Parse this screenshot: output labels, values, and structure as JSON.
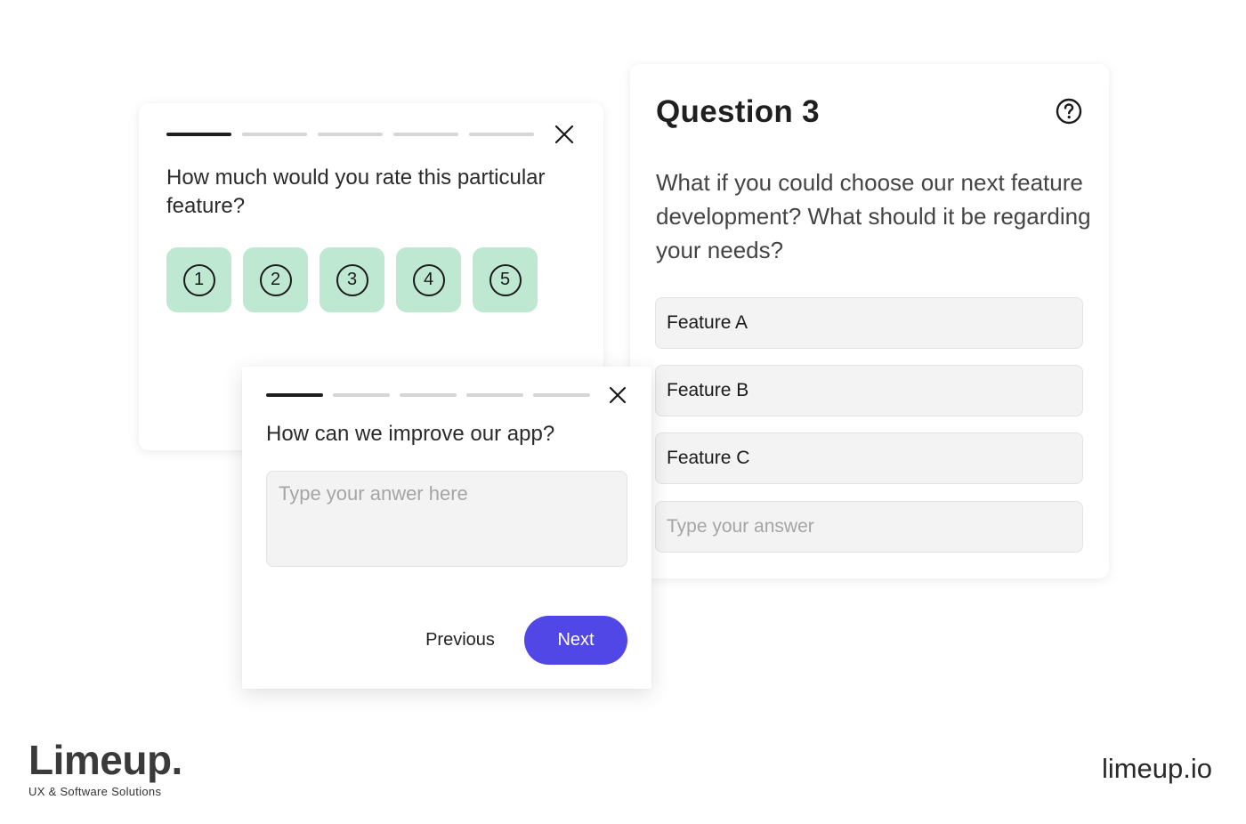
{
  "colors": {
    "accent": "#5146e6",
    "rating_bg": "#bfe8d2",
    "progress_active": "#1f1f1f",
    "progress_inactive": "#d6d6d6",
    "field_bg": "#f3f3f3"
  },
  "rating_card": {
    "progress": {
      "total_steps": 5,
      "current_step": 1
    },
    "close_icon": "close-icon",
    "question": "How much would you rate this particular feature?",
    "ratings": [
      "1",
      "2",
      "3",
      "4",
      "5"
    ]
  },
  "question_card": {
    "title": "Question 3",
    "help_icon": "help-circle-icon",
    "question": "What if you could choose our next feature development? What should it be regarding your needs?",
    "options": [
      "Feature A",
      "Feature B",
      "Feature C"
    ],
    "answer_placeholder": "Type your answer"
  },
  "text_card": {
    "progress": {
      "total_steps": 5,
      "current_step": 1
    },
    "close_icon": "close-icon",
    "question": "How can we improve our app?",
    "answer_placeholder": "Type your anwer here",
    "previous_label": "Previous",
    "next_label": "Next"
  },
  "branding": {
    "logo": "Limeup.",
    "tagline": "UX & Software Solutions",
    "url": "limeup.io"
  }
}
